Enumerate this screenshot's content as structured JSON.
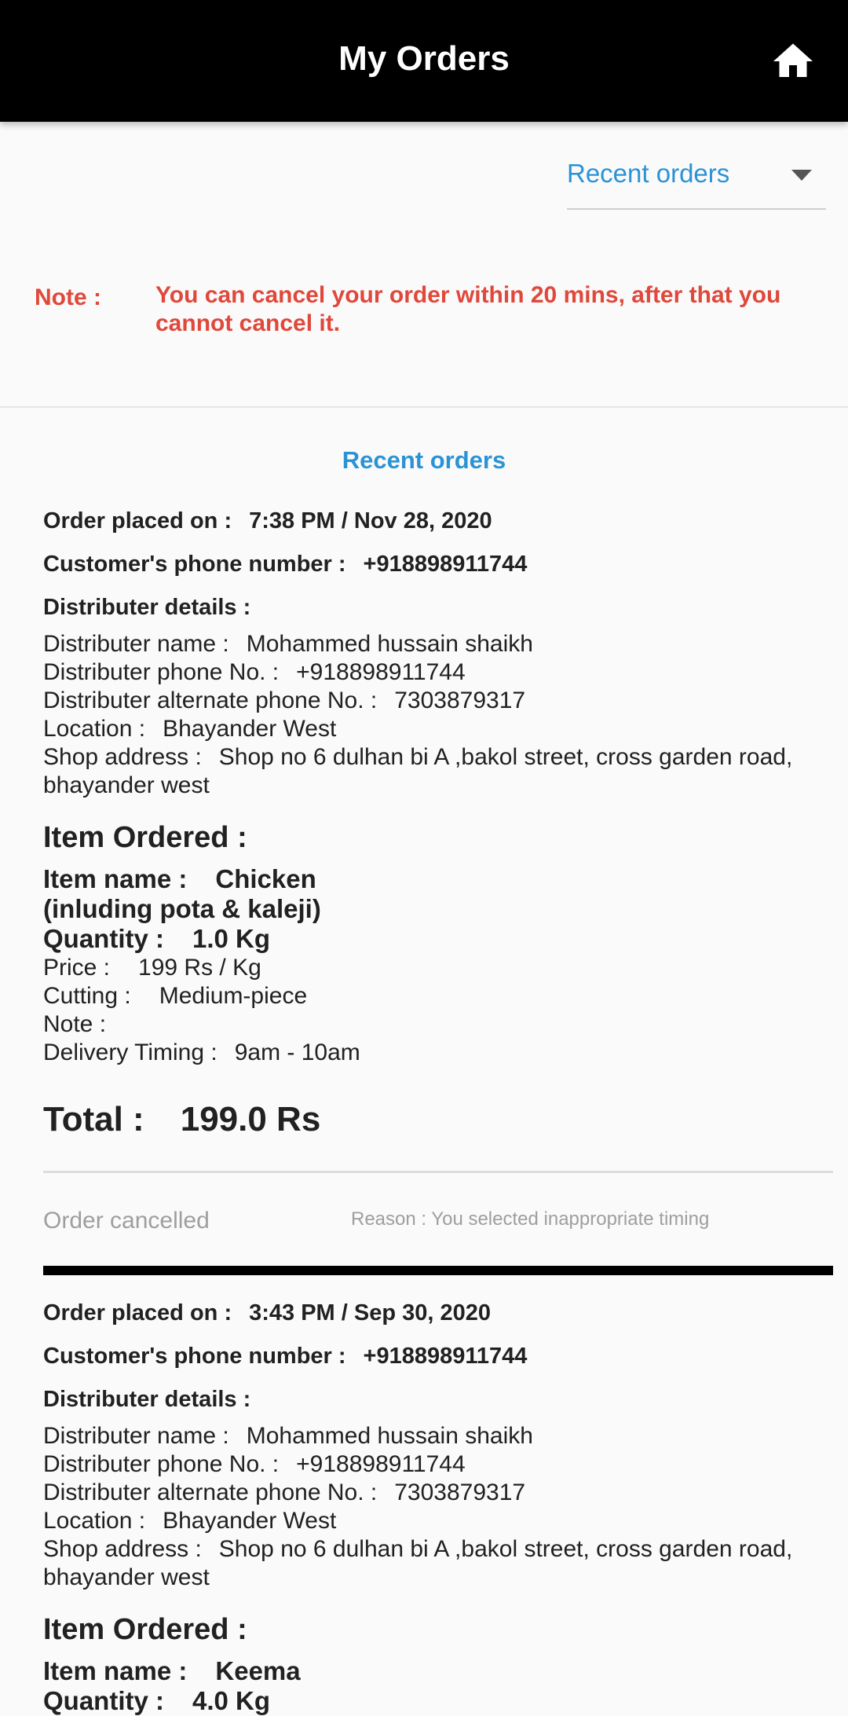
{
  "app": {
    "title": "My Orders",
    "home_icon": "home-icon"
  },
  "filter": {
    "selected": "Recent orders"
  },
  "note": {
    "label": "Note :",
    "text": "You can cancel your order within 20 mins, after that you cannot cancel it."
  },
  "section_title": "Recent orders",
  "labels": {
    "order_placed": "Order placed on :",
    "customer_phone": "Customer's phone number :",
    "distributer_details": "Distributer details :",
    "distributer_name": "Distributer name :",
    "distributer_phone": "Distributer phone No. :",
    "distributer_alt_phone": "Distributer alternate phone No. :",
    "location": "Location :",
    "shop_address": "Shop address :",
    "item_ordered": "Item Ordered :",
    "item_name": "Item name :",
    "quantity": "Quantity :",
    "price": "Price :",
    "cutting": "Cutting :",
    "note": "Note :",
    "delivery_timing": "Delivery Timing :",
    "total": "Total :"
  },
  "orders": [
    {
      "placed_on": "7:38 PM / Nov 28, 2020",
      "customer_phone": "+918898911744",
      "distributer_name": "Mohammed hussain shaikh",
      "distributer_phone": "+918898911744",
      "distributer_alt_phone": "7303879317",
      "location": "Bhayander West",
      "shop_address": "Shop no 6 dulhan bi A ,bakol street, cross garden road, bhayander west",
      "item_name": "Chicken",
      "item_name_sub": "(inluding pota & kaleji)",
      "quantity": "1.0  Kg",
      "price": "199 Rs / Kg",
      "cutting": "Medium-piece",
      "note": "",
      "delivery_timing": "9am  -  10am",
      "total": "199.0 Rs",
      "status": "Order cancelled",
      "reason": "Reason : You selected inappropriate timing"
    },
    {
      "placed_on": "3:43 PM / Sep 30, 2020",
      "customer_phone": "+918898911744",
      "distributer_name": "Mohammed hussain shaikh",
      "distributer_phone": "+918898911744",
      "distributer_alt_phone": "7303879317",
      "location": "Bhayander West",
      "shop_address": "Shop no 6 dulhan bi A ,bakol street, cross garden road, bhayander west",
      "item_name": "Keema",
      "quantity": "4.0  Kg"
    }
  ]
}
